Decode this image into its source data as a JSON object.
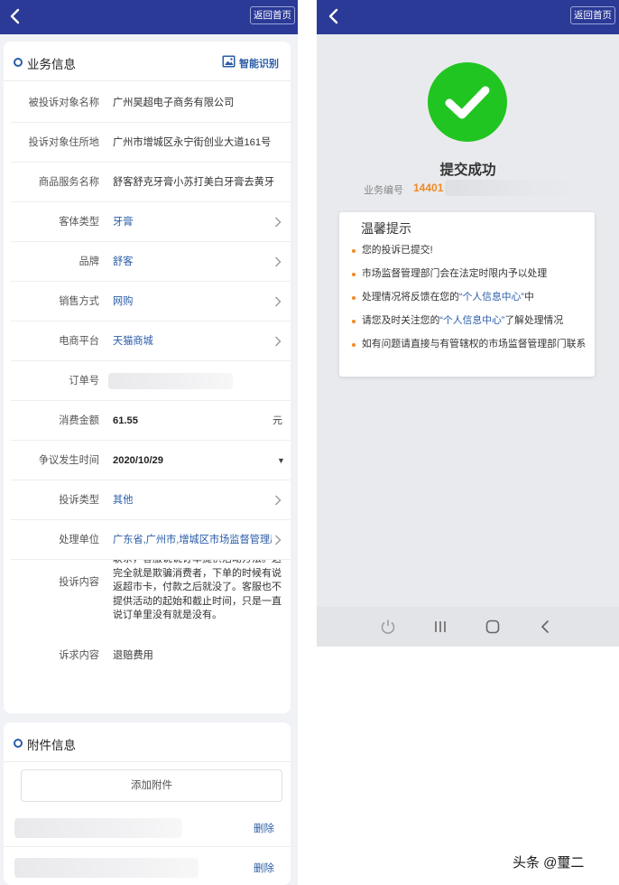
{
  "left": {
    "header": {
      "home_label": "返回首页"
    },
    "business": {
      "section_title": "业务信息",
      "smart_label": "智能识别",
      "fields": [
        {
          "label": "被投诉对象名称",
          "value": "广州昊超电子商务有限公司"
        },
        {
          "label": "投诉对象住所地",
          "value": "广州市增城区永宁街创业大道161号"
        },
        {
          "label": "商品服务名称",
          "value": "舒客舒克牙膏小苏打美白牙膏去黄牙"
        },
        {
          "label": "客体类型",
          "value": "牙膏"
        },
        {
          "label": "品牌",
          "value": "舒客"
        },
        {
          "label": "销售方式",
          "value": "网购"
        },
        {
          "label": "电商平台",
          "value": "天猫商城"
        },
        {
          "label": "订单号",
          "value": ""
        },
        {
          "label": "消费金额",
          "value": "61.55",
          "unit": "元"
        },
        {
          "label": "争议发生时间",
          "value": "2020/10/29"
        },
        {
          "label": "投诉类型",
          "value": "其他"
        },
        {
          "label": "处理单位",
          "value": "广东省,广州市,增城区市场监督管理局"
        },
        {
          "label": "投诉内容",
          "value": "联系，客服说说订单提供活动方法。这完全就是欺骗消费者，下单的时候有说返超市卡，付款之后就没了。客服也不提供活动的起始和截止时间，只是一直说订单里没有就是没有。"
        },
        {
          "label": "诉求内容",
          "value": "退赔费用"
        }
      ]
    },
    "attachments": {
      "section_title": "附件信息",
      "add_label": "添加附件",
      "delete_label": "删除"
    }
  },
  "right": {
    "header": {
      "home_label": "返回首页"
    },
    "success_title": "提交成功",
    "biz_no_label": "业务编号",
    "biz_no_value": "14401",
    "tips_title": "温馨提示",
    "tips": [
      {
        "pre": "您的投诉已提交!",
        "hl": "",
        "post": ""
      },
      {
        "pre": "市场监督管理部门会在法定时限内予以处理",
        "hl": "",
        "post": ""
      },
      {
        "pre": "处理情况将反馈在您的",
        "hl": "“个人信息中心”",
        "post": "中"
      },
      {
        "pre": "请您及时关注您的",
        "hl": "“个人信息中心”",
        "post": "了解处理情况"
      },
      {
        "pre": "如有问题请直接与有管辖权的市场监督管理部门联系",
        "hl": "",
        "post": ""
      }
    ]
  },
  "watermark": "头条 @璽二",
  "colors": {
    "header_bg": "#2b3a96",
    "accent_blue": "#2a5ca8",
    "success_green": "#21c521",
    "orange": "#f08a24"
  },
  "icons": [
    "chevron-left-icon",
    "chevron-right-icon",
    "image-scan-icon",
    "check-icon",
    "power-icon",
    "recent-apps-icon",
    "home-nav-icon",
    "back-nav-icon"
  ]
}
